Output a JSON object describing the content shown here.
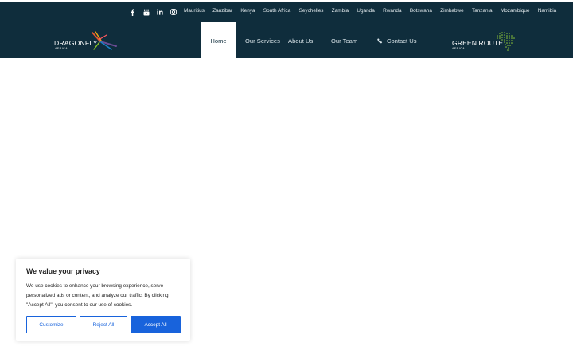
{
  "topbar": {
    "social": [
      {
        "icon": "facebook-icon"
      },
      {
        "icon": "youtube-icon"
      },
      {
        "icon": "linkedin-icon"
      },
      {
        "icon": "instagram-icon"
      }
    ],
    "countries": [
      "Mauritius",
      "Zanzibar",
      "Kenya",
      "South Africa",
      "Seychelles",
      "Zambia",
      "Uganda",
      "Rwanda",
      "Botswana",
      "Zimbabwe",
      "Tanzania",
      "Mozambique",
      "Namibia"
    ]
  },
  "logo_left": {
    "word": "DRAGONFLY",
    "sub": "AFRICA"
  },
  "logo_right": {
    "word": "GREEN ROUTE",
    "sub": "AFRICA"
  },
  "nav": {
    "home": "Home",
    "services": "Our Services",
    "about": "About Us",
    "team": "Our Team",
    "contact": "Contact Us"
  },
  "cookie": {
    "title": "We value your privacy",
    "text": "We use cookies to enhance your browsing experience, serve personalized ads or content, and analyze our traffic. By clicking \"Accept All\", you consent to our use of cookies.",
    "customize": "Customize",
    "reject": "Reject All",
    "accept": "Accept All"
  },
  "colors": {
    "header_bg": "#0f2d3c",
    "cookie_accent": "#1863dc"
  }
}
